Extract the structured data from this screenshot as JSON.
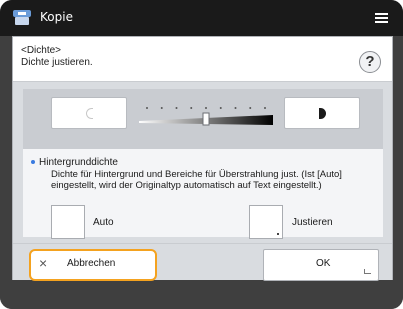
{
  "app": {
    "title": "Kopie",
    "icon": "copier-icon",
    "menu_icon": "menu-icon"
  },
  "dialog": {
    "title": "<Dichte>",
    "subtitle": "Dichte justieren.",
    "help_symbol": "?",
    "slider": {
      "lighter_icon": "density-light-icon",
      "darker_icon": "density-dark-icon",
      "steps": 9,
      "current_level": 5
    },
    "info": {
      "heading": "Hintergrunddichte",
      "text": "Dichte für Hintergrund und Bereiche für Überstrahlung just. (Ist [Auto] eingestellt, wird der Originaltyp automatisch auf Text eingestellt.)"
    },
    "options": {
      "auto_label": "Auto",
      "adjust_label": "Justieren"
    },
    "footer": {
      "cancel_icon": "×",
      "cancel_label": "Abbrechen",
      "ok_label": "OK"
    }
  },
  "colors": {
    "accent_highlight": "#f4a21f",
    "bullet": "#3a7be0",
    "titlebar": "#1a1a1a",
    "screen_bg": "#3f3f3f"
  }
}
